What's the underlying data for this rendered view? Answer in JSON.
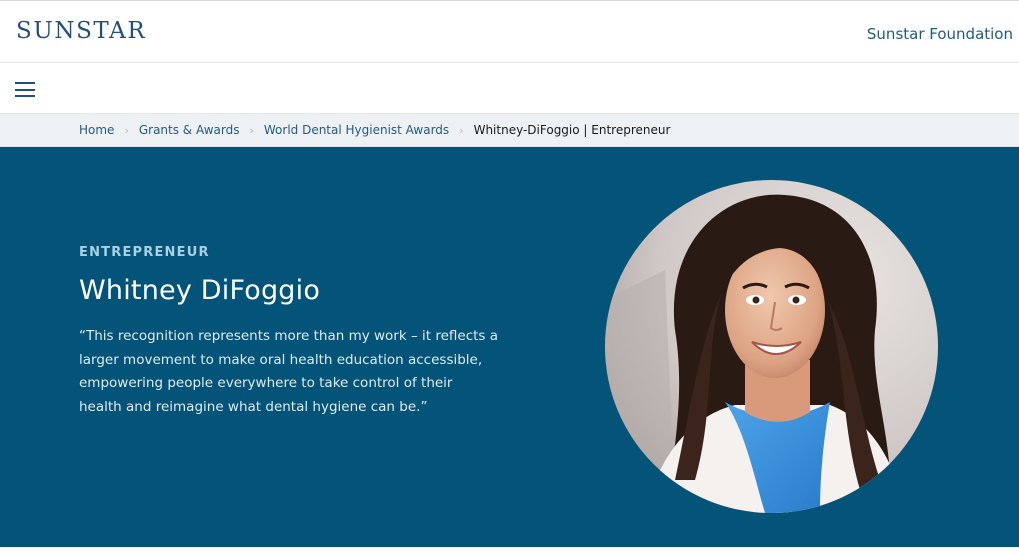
{
  "header": {
    "logo_text": "SUNSTAR",
    "foundation_link": "Sunstar Foundation"
  },
  "menu": {
    "icon": "hamburger-menu-icon"
  },
  "breadcrumb": {
    "items": [
      "Home",
      "Grants & Awards",
      "World Dental Hygienist Awards"
    ],
    "current": "Whitney-DiFoggio | Entrepreneur",
    "separator_icon": "chevron-right-icon"
  },
  "hero": {
    "eyebrow": "ENTREPRENEUR",
    "name": "Whitney DiFoggio",
    "quote": "“This recognition represents more than my work – it reflects a larger movement to make oral health education accessible, empowering people everywhere to take control of their health and reimagine what dental hygiene can be.”",
    "background_color": "#045479"
  },
  "colors": {
    "brand": "#1f4f7a",
    "link": "#1f5a85",
    "hero_bg": "#045479",
    "eyebrow": "#a9d0e4"
  }
}
